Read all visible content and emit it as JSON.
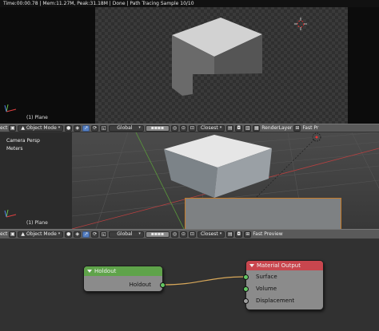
{
  "render_view": {
    "stats": "Time:00:00.78 | Mem:11.27M, Peak:31.18M | Done | Path Tracing Sample 10/10",
    "object_label": "(1) Plane"
  },
  "header_top": {
    "partial_label": "ect",
    "mode": "Object Mode",
    "orientation": "Global",
    "snap": "Closest",
    "render_layer": "RenderLayer",
    "preview_label": "Fast Pr"
  },
  "viewport": {
    "view_name": "Camera Persp",
    "units": "Meters",
    "object_label": "(1) Plane"
  },
  "header_bottom": {
    "partial_label": "ect",
    "mode": "Object Mode",
    "orientation": "Global",
    "snap": "Closest",
    "preview_label": "Fast Preview"
  },
  "node_editor": {
    "holdout_node": {
      "title": "Holdout",
      "output_label": "Holdout",
      "header_color": "#5fa34a"
    },
    "material_output_node": {
      "title": "Material Output",
      "inputs": [
        "Surface",
        "Volume",
        "Displacement"
      ],
      "header_color": "#c9464e"
    },
    "link_color": "#d8a85a"
  },
  "icons": [
    "render-engine-icon",
    "mode-icon",
    "viewport-shading-icon",
    "pivot-icon",
    "manipulator-icon",
    "layers-icon",
    "snap-icon",
    "render-icon",
    "camera-icon",
    "axis-gizmo-icon",
    "3d-cursor-icon"
  ]
}
